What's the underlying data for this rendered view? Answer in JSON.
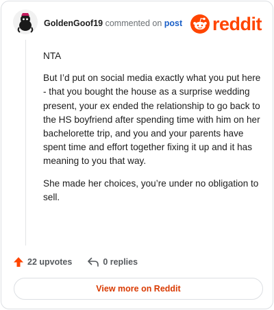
{
  "comment": {
    "username": "GoldenGoof19",
    "action_text": "commented on",
    "post_link_label": "post",
    "paragraphs": [
      "NTA",
      "But I’d put on social media exactly what you put here - that you bought the house as a surprise wedding present, your ex ended the relationship to go back to the HS boyfriend after spending time with him on her bachelorette trip, and you and your parents have spent time and effort together fixing it up and it has meaning to you that way.",
      "She made her choices, you’re under no obligation to sell."
    ]
  },
  "brand": {
    "wordmark": "reddit",
    "color": "#ff4500"
  },
  "actions": {
    "upvotes_label": "22 upvotes",
    "replies_label": "0 replies"
  },
  "footer": {
    "view_more_label": "View more on Reddit"
  },
  "icons": {
    "avatar": "avatar-icon",
    "logo": "reddit-snoo-icon",
    "upvote": "upvote-arrow-icon",
    "reply": "reply-arrow-icon"
  }
}
